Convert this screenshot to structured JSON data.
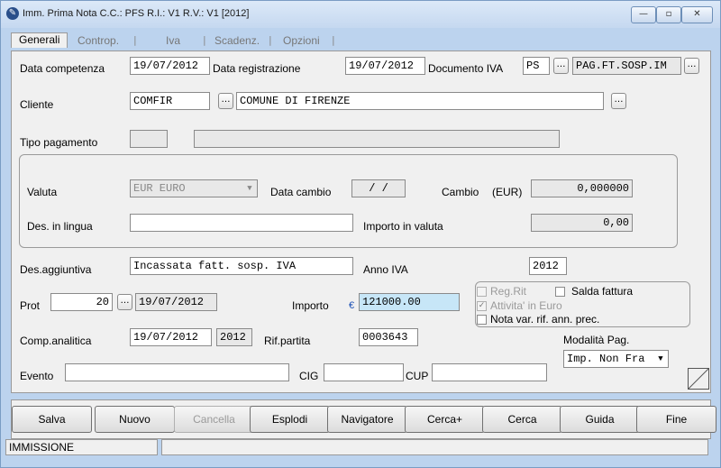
{
  "window": {
    "title": "Imm. Prima Nota C.C.: PFS  R.I.: V1  R.V.: V1  [2012]",
    "min_label": "—",
    "max_label": "▫",
    "close_label": "✕"
  },
  "tabs": [
    "Generali",
    "Controp.",
    "Iva",
    "Scadenz.",
    "Opzioni"
  ],
  "form": {
    "data_competenza": {
      "label": "Data competenza",
      "value": "19/07/2012"
    },
    "data_registrazione": {
      "label": "Data registrazione",
      "value": "19/07/2012"
    },
    "documento_iva": {
      "label": "Documento IVA",
      "code": "PS",
      "desc": "PAG.FT.SOSP.IM"
    },
    "cliente": {
      "label": "Cliente",
      "code": "COMFIR",
      "name": "COMUNE DI FIRENZE"
    },
    "tipo_pagamento": {
      "label": "Tipo pagamento"
    },
    "valuta": {
      "label": "Valuta",
      "value": "EUR EURO"
    },
    "data_cambio": {
      "label": "Data cambio",
      "value": "/ /"
    },
    "cambio": {
      "label": "Cambio",
      "currency": "(EUR)",
      "value": "0,000000"
    },
    "des_lingua": {
      "label": "Des. in lingua"
    },
    "importo_valuta": {
      "label": "Importo in valuta",
      "value": "0,00"
    },
    "des_aggiuntiva": {
      "label": "Des.aggiuntiva",
      "value": "Incassata fatt. sosp. IVA"
    },
    "anno_iva": {
      "label": "Anno IVA",
      "value": "2012"
    },
    "prot": {
      "label": "Prot",
      "number": "20",
      "date": "19/07/2012"
    },
    "importo": {
      "label": "Importo",
      "currency_symbol": "€",
      "value": "121000.00"
    },
    "checks": {
      "reg_rit": "Reg.Rit",
      "salda_fattura": "Salda fattura",
      "attivita_euro": "Attivita' in Euro",
      "nota_var": "Nota var. rif. ann. prec."
    },
    "comp_analitica": {
      "label": "Comp.analitica",
      "date": "19/07/2012",
      "year": "2012"
    },
    "rif_partita": {
      "label": "Rif.partita",
      "value": "0003643"
    },
    "modalita_pag": {
      "label": "Modalità Pag.",
      "value": "Imp. Non Fra"
    },
    "evento": {
      "label": "Evento"
    },
    "cig": {
      "label": "CIG"
    },
    "cup": {
      "label": "CUP"
    }
  },
  "buttons": {
    "salva": "Salva",
    "nuovo": "Nuovo",
    "cancella": "Cancella",
    "esplodi": "Esplodi",
    "navigatore": "Navigatore",
    "cerca_plus": "Cerca+",
    "cerca": "Cerca",
    "guida": "Guida",
    "fine": "Fine"
  },
  "status": {
    "mode": "IMMISSIONE"
  },
  "icons": {
    "dots_button": "ellipsis-icon",
    "dropdown": "chevron-down-icon",
    "app": "app-icon",
    "corner": "corner-triangle-icon"
  }
}
